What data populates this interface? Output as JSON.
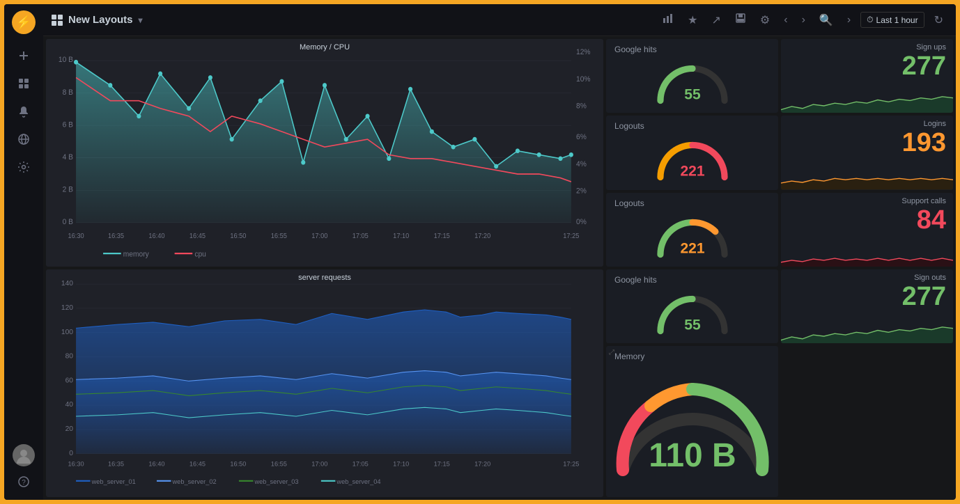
{
  "app": {
    "logo": "🔥",
    "title": "New Layouts",
    "dropdown_arrow": "▾"
  },
  "topbar": {
    "icons": [
      "chart-bar",
      "star",
      "share",
      "save",
      "gear",
      "chevron-left",
      "chevron-right",
      "search",
      "chevron-right2"
    ],
    "time_label": "Last 1 hour",
    "refresh_icon": "↻"
  },
  "sidebar": {
    "icons": [
      "plus",
      "grid",
      "bell",
      "globe",
      "gear"
    ],
    "bottom_icons": [
      "user",
      "question"
    ]
  },
  "charts": {
    "memory_cpu": {
      "title": "Memory / CPU",
      "legend": [
        "memory",
        "cpu"
      ],
      "y_left_labels": [
        "10 B",
        "8 B",
        "6 B",
        "4 B",
        "2 B",
        "0 B"
      ],
      "y_right_labels": [
        "12%",
        "10%",
        "8%",
        "6%",
        "4%",
        "2%",
        "0%"
      ],
      "x_labels": [
        "16:30",
        "16:35",
        "16:40",
        "16:45",
        "16:50",
        "16:55",
        "17:00",
        "17:05",
        "17:10",
        "17:15",
        "17:20",
        "17:25"
      ]
    },
    "server_requests": {
      "title": "server requests",
      "y_labels": [
        "140",
        "120",
        "100",
        "80",
        "60",
        "40",
        "20",
        "0"
      ],
      "x_labels": [
        "16:30",
        "16:35",
        "16:40",
        "16:45",
        "16:50",
        "16:55",
        "17:00",
        "17:05",
        "17:10",
        "17:15",
        "17:20",
        "17:25"
      ],
      "legend": [
        "web_server_01",
        "web_server_02",
        "web_server_03",
        "web_server_04"
      ]
    }
  },
  "gauges": {
    "google_hits": {
      "title": "Google hits",
      "value": "55",
      "value_color": "green",
      "arc_color": "#73bf69"
    },
    "logouts_1": {
      "title": "Logouts",
      "value": "221",
      "value_color": "red",
      "arc_color": "#f2495c"
    },
    "logouts_2": {
      "title": "Logouts",
      "value": "221",
      "value_color": "orange",
      "arc_color": "#ff9830"
    },
    "google_hits_2": {
      "title": "Google hits",
      "value": "55",
      "value_color": "green",
      "arc_color": "#73bf69"
    },
    "memory": {
      "title": "Memory",
      "value": "110 B",
      "value_color": "green",
      "arc_color": "#73bf69"
    }
  },
  "stats": {
    "sign_ups": {
      "title": "Sign ups",
      "value": "277",
      "value_color": "green"
    },
    "logins": {
      "title": "Logins",
      "value": "193",
      "value_color": "orange"
    },
    "support_calls": {
      "title": "Support calls",
      "value": "84",
      "value_color": "red"
    },
    "sign_outs": {
      "title": "Sign outs",
      "value": "277",
      "value_color": "green"
    }
  }
}
